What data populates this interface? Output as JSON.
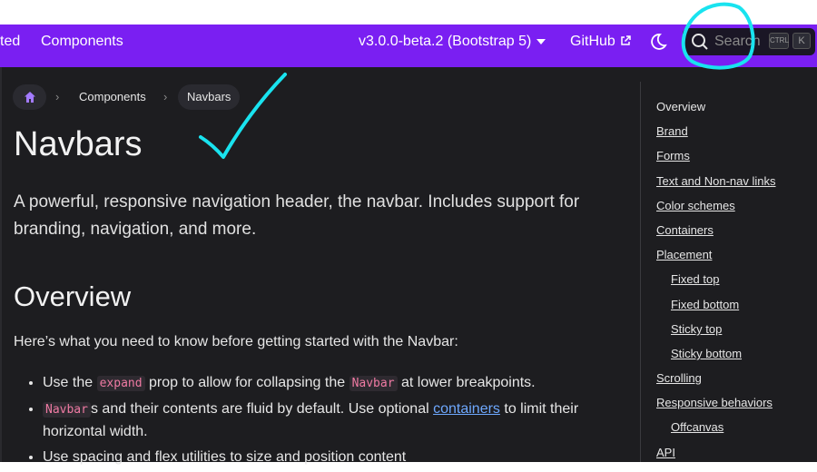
{
  "navbar": {
    "brand_partial": "ted",
    "components_label": "Components",
    "version_label": "v3.0.0-beta.2 (Bootstrap 5)",
    "github_label": "GitHub",
    "search": {
      "placeholder": "Search",
      "kbd_ctrl": "CTRL",
      "kbd_k": "K"
    }
  },
  "breadcrumb": {
    "items": [
      "Components",
      "Navbars"
    ]
  },
  "page": {
    "title": "Navbars",
    "lead": "A powerful, responsive navigation header, the navbar. Includes support for branding, navigation, and more.",
    "section_title": "Overview",
    "intro": "Here’s what you need to know before getting started with the Navbar:",
    "bullets": {
      "b1_pre": "Use the ",
      "b1_code1": "expand",
      "b1_mid": " prop to allow for collapsing the ",
      "b1_code2": "Navbar",
      "b1_post": " at lower breakpoints.",
      "b2_code": "Navbar",
      "b2_mid": "s and their contents are fluid by default. Use optional ",
      "b2_link": "containers",
      "b2_post": " to limit their horizontal width.",
      "b3": "Use spacing and flex utilities to size and position content"
    }
  },
  "toc": {
    "items": [
      "Overview",
      "Brand",
      "Forms",
      "Text and Non-nav links",
      "Color schemes",
      "Containers",
      "Placement",
      "Fixed top",
      "Fixed bottom",
      "Sticky top",
      "Sticky bottom",
      "Scrolling",
      "Responsive behaviors",
      "Offcanvas",
      "API"
    ]
  },
  "colors": {
    "navbar_bg": "#7a1ff2",
    "main_bg": "#1d1d20",
    "annotation": "#19e3ef",
    "link": "#6ea8fe",
    "code_text": "#ef7aa3"
  }
}
